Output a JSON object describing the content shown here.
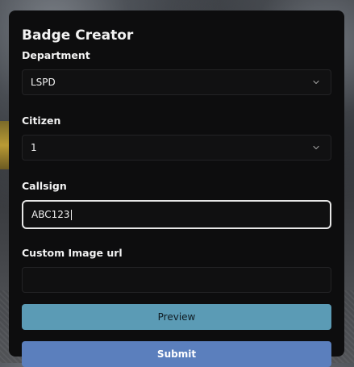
{
  "form": {
    "title": "Badge Creator",
    "department": {
      "label": "Department",
      "value": "LSPD"
    },
    "citizen": {
      "label": "Citizen",
      "value": "1"
    },
    "callsign": {
      "label": "Callsign",
      "value": "ABC123"
    },
    "custom_image": {
      "label": "Custom Image url",
      "value": ""
    },
    "preview_button": "Preview",
    "submit_button": "Submit"
  },
  "colors": {
    "panel_bg": "#0d0d0e",
    "preview_button": "#5b9bb5",
    "submit_button": "#5b7fbd",
    "focused_border": "#e7e7e7"
  },
  "icons": {
    "select_arrow": "chevron-down-icon"
  }
}
